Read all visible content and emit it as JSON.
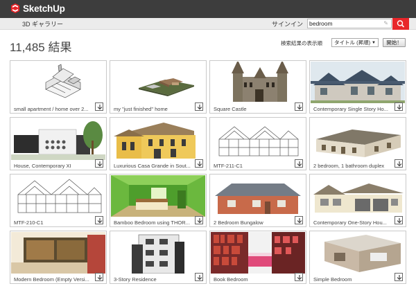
{
  "header": {
    "brand": "SketchUp",
    "gallery_link": "3D ギャラリー",
    "signin": "サインイン",
    "search_value": "bedroom"
  },
  "results": {
    "count_text": "11,485 結果",
    "sort_label": "検索結果の表示順",
    "sort_value": "タイトル (昇順)",
    "sort_button": "開始！"
  },
  "colors": {
    "topbar": "#3d3d3d",
    "accent": "#e8262a",
    "subbar": "#ececec"
  },
  "items": [
    {
      "title": "small apartment / home over 2..."
    },
    {
      "title": "my \"just finished\" home"
    },
    {
      "title": "Square Castle"
    },
    {
      "title": "Contemporary Single Story Ho..."
    },
    {
      "title": "House, Contemporary XI"
    },
    {
      "title": "Luxurious Casa Grande in Sout..."
    },
    {
      "title": "MTF-211-C1"
    },
    {
      "title": "2 bedroom, 1 bathroom duplex"
    },
    {
      "title": "MTF-210-C1"
    },
    {
      "title": "Bamboo Bedroom using THOR..."
    },
    {
      "title": "2 Bedroom Bungalow"
    },
    {
      "title": "Contemporary One-Story Hou..."
    },
    {
      "title": "Modern Bedroom (Empty Versi..."
    },
    {
      "title": "3-Story Residence"
    },
    {
      "title": "Book Bedroom"
    },
    {
      "title": "Simple Bedroom"
    }
  ],
  "icons": {
    "download": "download-icon",
    "search": "search-icon",
    "clear": "clear-icon",
    "logo": "sketchup-logo-icon"
  }
}
